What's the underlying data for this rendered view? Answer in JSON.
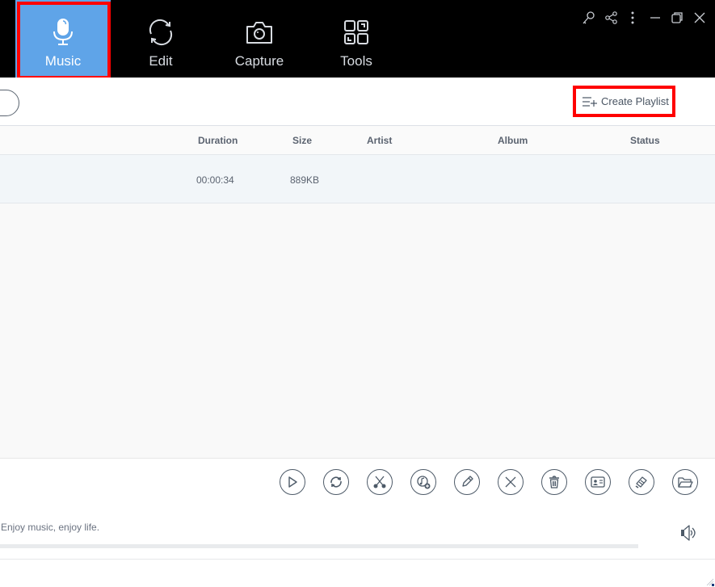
{
  "nav": {
    "tabs": [
      {
        "label": "Music",
        "icon": "microphone-icon",
        "active": true
      },
      {
        "label": "Edit",
        "icon": "convert-icon",
        "active": false
      },
      {
        "label": "Capture",
        "icon": "camera-icon",
        "active": false
      },
      {
        "label": "Tools",
        "icon": "tools-grid-icon",
        "active": false
      }
    ],
    "window_controls": [
      "key-icon",
      "share-icon",
      "more-icon",
      "minimize-icon",
      "restore-icon",
      "close-icon"
    ]
  },
  "toolbar": {
    "create_playlist_label": "Create Playlist"
  },
  "table": {
    "columns": [
      "Duration",
      "Size",
      "Artist",
      "Album",
      "Status"
    ],
    "rows": [
      {
        "duration": "00:00:34",
        "size": "889KB",
        "artist": "",
        "album": "",
        "status": ""
      }
    ]
  },
  "actions": [
    "play",
    "convert",
    "cut",
    "add-to-itunes",
    "edit-tags",
    "remove",
    "delete",
    "id3-card",
    "burn-cd",
    "open-folder"
  ],
  "player": {
    "slogan": "Enjoy music, enjoy life.",
    "progress": 0
  },
  "colors": {
    "accent": "#5fa4e8",
    "highlight_border": "#ff0000",
    "topbar_bg": "#000000"
  }
}
